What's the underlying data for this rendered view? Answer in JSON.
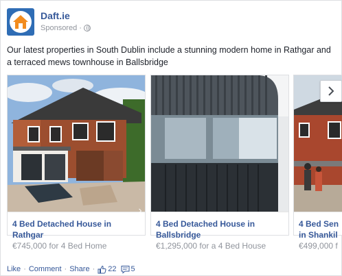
{
  "post": {
    "page_name": "Daft.ie",
    "sponsored_label": "Sponsored",
    "sponsored_sep": "·",
    "body_text": "Our latest properties in South Dublin include a stunning modern home in Rathgar and a terraced mews townhouse in Ballsbridge"
  },
  "cards": [
    {
      "title_line1": "4 Bed Detached House in",
      "title_line2": "Rathgar",
      "price": "€745,000 for 4 Bed Home"
    },
    {
      "title_line1": "4 Bed Detached House in",
      "title_line2": "Ballsbridge",
      "price": "€1,295,000 for a 4 Bed House"
    },
    {
      "title_line1": "4 Bed Sen",
      "title_line2": "in Shankil",
      "price": "€499,000 f"
    }
  ],
  "footer": {
    "like_label": "Like",
    "comment_label": "Comment",
    "share_label": "Share",
    "sep": "·",
    "likes_count": "22",
    "comments_count": "5"
  },
  "colors": {
    "link_blue": "#365899",
    "meta_grey": "#90949c",
    "brand_blue": "#2f6db5",
    "brand_orange": "#f28c1e"
  },
  "icons": {
    "logo": "daft-house-logo",
    "globe": "globe-icon",
    "next": "chevron-right-icon",
    "like": "thumbs-up-icon",
    "comment": "comment-bubble-icon"
  }
}
